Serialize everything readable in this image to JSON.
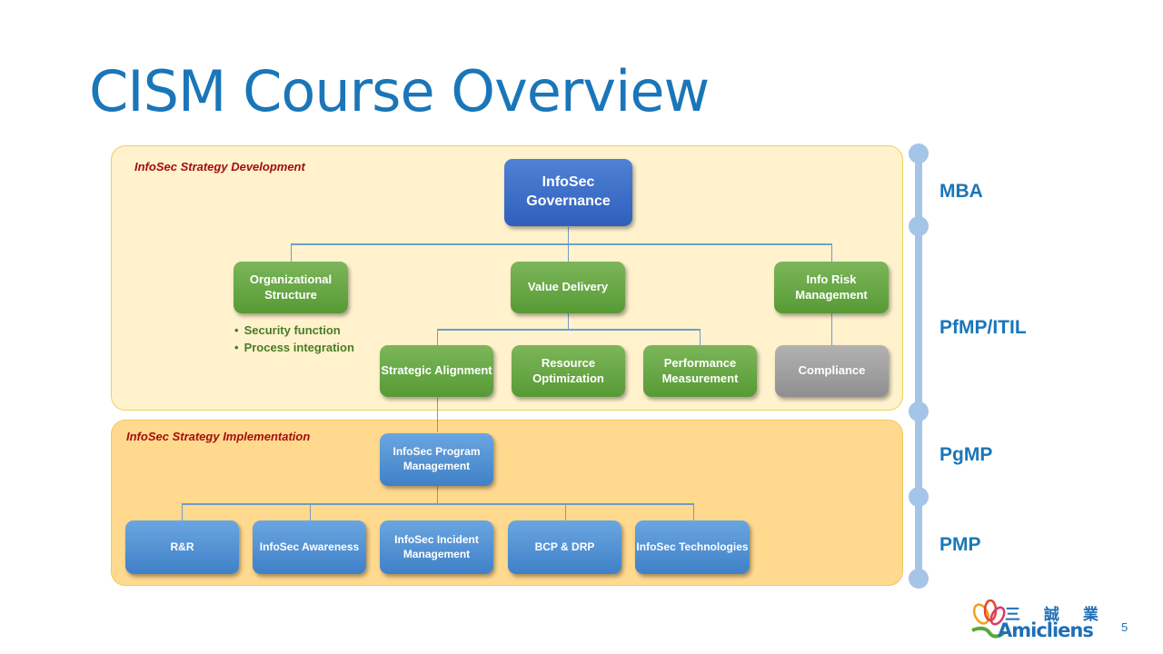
{
  "title": "CISM Course Overview",
  "page_number": "5",
  "logo": {
    "chinese": "三 誠 業",
    "english": "Amicliens"
  },
  "sections": {
    "development": {
      "label": "InfoSec Strategy Development"
    },
    "implementation": {
      "label": "InfoSec Strategy Implementation"
    }
  },
  "nodes": {
    "governance": "InfoSec Governance",
    "org_structure": "Organizational Structure",
    "value_delivery": "Value Delivery",
    "info_risk": "Info Risk Management",
    "strategic_alignment": "Strategic Alignment",
    "resource_optimization": "Resource Optimization",
    "performance_measurement": "Performance Measurement",
    "compliance": "Compliance",
    "program_management": "InfoSec Program Management",
    "rr": "R&R",
    "awareness": "InfoSec Awareness",
    "incident": "InfoSec Incident Management",
    "bcp_drp": "BCP & DRP",
    "technologies": "InfoSec Technologies"
  },
  "org_structure_bullets": [
    "Security function",
    "Process integration"
  ],
  "levels": [
    "MBA",
    "PfMP/ITIL",
    "PgMP",
    "PMP"
  ],
  "colors": {
    "title": "#1a76b8",
    "section_label": "#a50d0d",
    "governance": "#3a6cc6",
    "green_node": "#6aa948",
    "gray_node": "#a0a0a0",
    "blue_node": "#5092d4",
    "track": "#a4c4e8"
  }
}
